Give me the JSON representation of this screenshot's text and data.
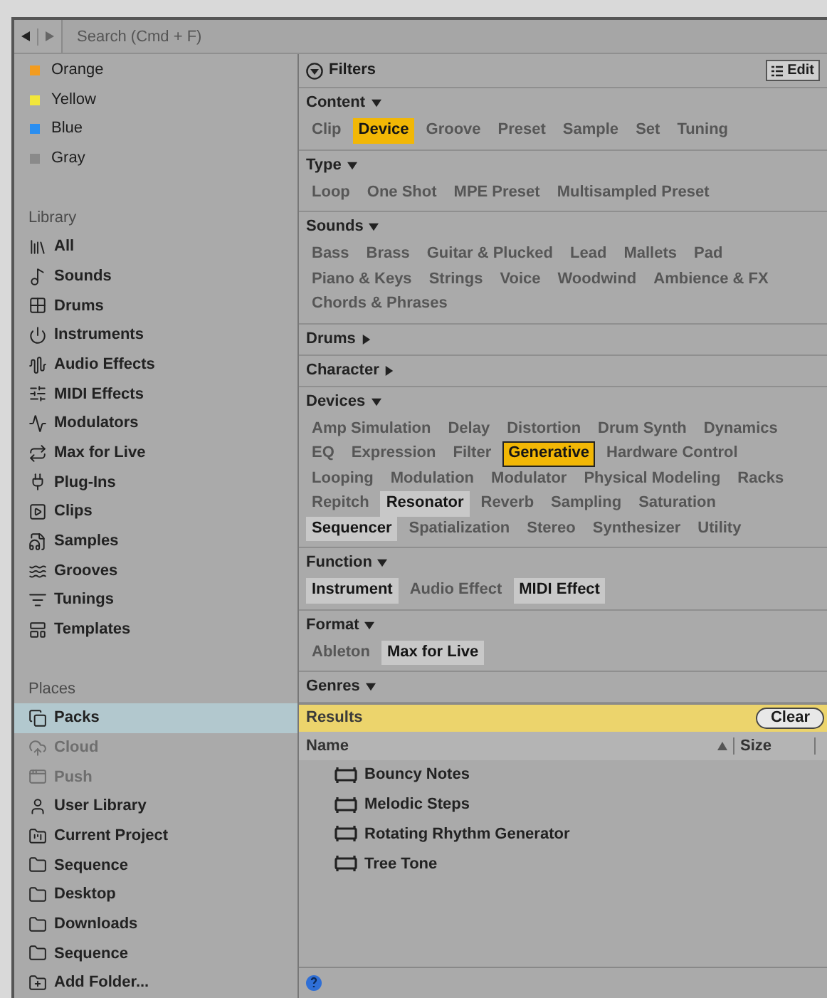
{
  "search": {
    "placeholder": "Search (Cmd + F)"
  },
  "sidebar": {
    "colors": [
      {
        "label": "Orange",
        "color": "#f39c1f"
      },
      {
        "label": "Yellow",
        "color": "#f2e63a"
      },
      {
        "label": "Blue",
        "color": "#2a8ef0"
      },
      {
        "label": "Gray",
        "color": "#8a8a8a"
      }
    ],
    "library": {
      "title": "Library",
      "items": [
        {
          "label": "All"
        },
        {
          "label": "Sounds"
        },
        {
          "label": "Drums"
        },
        {
          "label": "Instruments"
        },
        {
          "label": "Audio Effects"
        },
        {
          "label": "MIDI Effects"
        },
        {
          "label": "Modulators"
        },
        {
          "label": "Max for Live"
        },
        {
          "label": "Plug-Ins"
        },
        {
          "label": "Clips"
        },
        {
          "label": "Samples"
        },
        {
          "label": "Grooves"
        },
        {
          "label": "Tunings"
        },
        {
          "label": "Templates"
        }
      ]
    },
    "places": {
      "title": "Places",
      "items": [
        {
          "label": "Packs",
          "selected": true,
          "disabled": false
        },
        {
          "label": "Cloud",
          "selected": false,
          "disabled": true
        },
        {
          "label": "Push",
          "selected": false,
          "disabled": true
        },
        {
          "label": "User Library",
          "selected": false,
          "disabled": false
        },
        {
          "label": "Current Project",
          "selected": false,
          "disabled": false
        },
        {
          "label": "Sequence",
          "selected": false,
          "disabled": false
        },
        {
          "label": "Desktop",
          "selected": false,
          "disabled": false
        },
        {
          "label": "Downloads",
          "selected": false,
          "disabled": false
        },
        {
          "label": "Sequence",
          "selected": false,
          "disabled": false
        },
        {
          "label": "Add Folder...",
          "selected": false,
          "disabled": false
        }
      ]
    }
  },
  "filters": {
    "title": "Filters",
    "edit_button": "Edit",
    "sections": [
      {
        "label": "Content",
        "expanded": true,
        "tags": [
          {
            "label": "Clip",
            "selected": false,
            "focused": false,
            "highlighted": false
          },
          {
            "label": "Device",
            "selected": true,
            "focused": false,
            "highlighted": false
          },
          {
            "label": "Groove",
            "selected": false,
            "focused": false,
            "highlighted": false
          },
          {
            "label": "Preset",
            "selected": false,
            "focused": false,
            "highlighted": false
          },
          {
            "label": "Sample",
            "selected": false,
            "focused": false,
            "highlighted": false
          },
          {
            "label": "Set",
            "selected": false,
            "focused": false,
            "highlighted": false
          },
          {
            "label": "Tuning",
            "selected": false,
            "focused": false,
            "highlighted": false
          }
        ]
      },
      {
        "label": "Type",
        "expanded": true,
        "tags": [
          {
            "label": "Loop",
            "selected": false,
            "focused": false,
            "highlighted": false
          },
          {
            "label": "One Shot",
            "selected": false,
            "focused": false,
            "highlighted": false
          },
          {
            "label": "MPE Preset",
            "selected": false,
            "focused": false,
            "highlighted": false
          },
          {
            "label": "Multisampled Preset",
            "selected": false,
            "focused": false,
            "highlighted": false
          }
        ]
      },
      {
        "label": "Sounds",
        "expanded": true,
        "tags": [
          {
            "label": "Bass",
            "selected": false,
            "focused": false,
            "highlighted": false
          },
          {
            "label": "Brass",
            "selected": false,
            "focused": false,
            "highlighted": false
          },
          {
            "label": "Guitar & Plucked",
            "selected": false,
            "focused": false,
            "highlighted": false
          },
          {
            "label": "Lead",
            "selected": false,
            "focused": false,
            "highlighted": false
          },
          {
            "label": "Mallets",
            "selected": false,
            "focused": false,
            "highlighted": false
          },
          {
            "label": "Pad",
            "selected": false,
            "focused": false,
            "highlighted": false
          },
          {
            "label": "Piano & Keys",
            "selected": false,
            "focused": false,
            "highlighted": false
          },
          {
            "label": "Strings",
            "selected": false,
            "focused": false,
            "highlighted": false
          },
          {
            "label": "Voice",
            "selected": false,
            "focused": false,
            "highlighted": false
          },
          {
            "label": "Woodwind",
            "selected": false,
            "focused": false,
            "highlighted": false
          },
          {
            "label": "Ambience & FX",
            "selected": false,
            "focused": false,
            "highlighted": false
          },
          {
            "label": "Chords & Phrases",
            "selected": false,
            "focused": false,
            "highlighted": false
          }
        ]
      },
      {
        "label": "Drums",
        "expanded": false
      },
      {
        "label": "Character",
        "expanded": false
      },
      {
        "label": "Devices",
        "expanded": true,
        "tags": [
          {
            "label": "Amp Simulation",
            "selected": false,
            "focused": false,
            "highlighted": false
          },
          {
            "label": "Delay",
            "selected": false,
            "focused": false,
            "highlighted": false
          },
          {
            "label": "Distortion",
            "selected": false,
            "focused": false,
            "highlighted": false
          },
          {
            "label": "Drum Synth",
            "selected": false,
            "focused": false,
            "highlighted": false
          },
          {
            "label": "Dynamics",
            "selected": false,
            "focused": false,
            "highlighted": false
          },
          {
            "label": "EQ",
            "selected": false,
            "focused": false,
            "highlighted": false
          },
          {
            "label": "Expression",
            "selected": false,
            "focused": false,
            "highlighted": false
          },
          {
            "label": "Filter",
            "selected": false,
            "focused": false,
            "highlighted": false
          },
          {
            "label": "Generative",
            "selected": true,
            "focused": true,
            "highlighted": false
          },
          {
            "label": "Hardware Control",
            "selected": false,
            "focused": false,
            "highlighted": false
          },
          {
            "label": "Looping",
            "selected": false,
            "focused": false,
            "highlighted": false
          },
          {
            "label": "Modulation",
            "selected": false,
            "focused": false,
            "highlighted": false
          },
          {
            "label": "Modulator",
            "selected": false,
            "focused": false,
            "highlighted": false
          },
          {
            "label": "Physical Modeling",
            "selected": false,
            "focused": false,
            "highlighted": false
          },
          {
            "label": "Racks",
            "selected": false,
            "focused": false,
            "highlighted": false
          },
          {
            "label": "Repitch",
            "selected": false,
            "focused": false,
            "highlighted": false
          },
          {
            "label": "Resonator",
            "selected": false,
            "focused": false,
            "highlighted": true
          },
          {
            "label": "Reverb",
            "selected": false,
            "focused": false,
            "highlighted": false
          },
          {
            "label": "Sampling",
            "selected": false,
            "focused": false,
            "highlighted": false
          },
          {
            "label": "Saturation",
            "selected": false,
            "focused": false,
            "highlighted": false
          },
          {
            "label": "Sequencer",
            "selected": false,
            "focused": false,
            "highlighted": true
          },
          {
            "label": "Spatialization",
            "selected": false,
            "focused": false,
            "highlighted": false
          },
          {
            "label": "Stereo",
            "selected": false,
            "focused": false,
            "highlighted": false
          },
          {
            "label": "Synthesizer",
            "selected": false,
            "focused": false,
            "highlighted": false
          },
          {
            "label": "Utility",
            "selected": false,
            "focused": false,
            "highlighted": false
          }
        ]
      },
      {
        "label": "Function",
        "expanded": true,
        "tags": [
          {
            "label": "Instrument",
            "selected": false,
            "focused": false,
            "highlighted": true
          },
          {
            "label": "Audio Effect",
            "selected": false,
            "focused": false,
            "highlighted": false
          },
          {
            "label": "MIDI Effect",
            "selected": false,
            "focused": false,
            "highlighted": true
          }
        ]
      },
      {
        "label": "Format",
        "expanded": true,
        "tags": [
          {
            "label": "Ableton",
            "selected": false,
            "focused": false,
            "highlighted": false
          },
          {
            "label": "Max for Live",
            "selected": false,
            "focused": false,
            "highlighted": true
          }
        ]
      },
      {
        "label": "Genres",
        "expanded": true
      }
    ]
  },
  "results": {
    "title": "Results",
    "clear_button": "Clear",
    "columns": [
      "Name",
      "Size"
    ],
    "rows": [
      "Bouncy Notes",
      "Melodic Steps",
      "Rotating Rhythm Generator",
      "Tree Tone"
    ]
  }
}
